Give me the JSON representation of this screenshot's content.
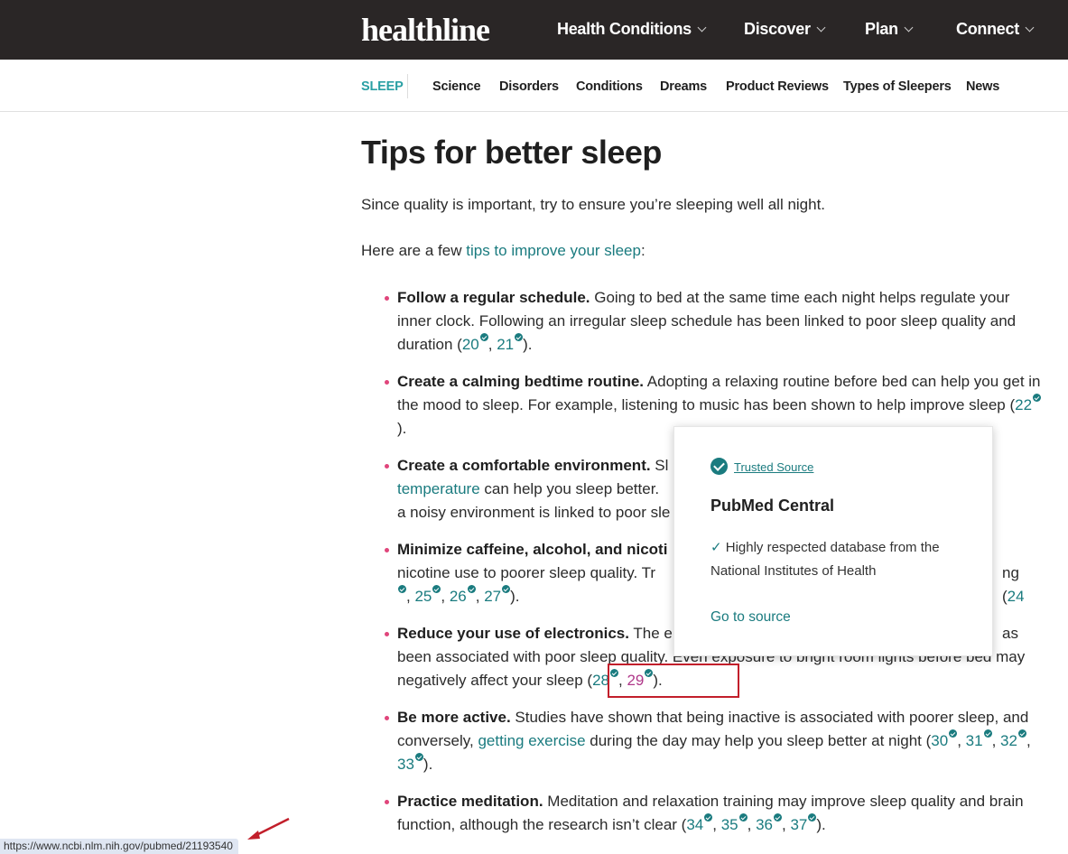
{
  "header": {
    "logo": "healthline",
    "nav": [
      {
        "label": "Health Conditions"
      },
      {
        "label": "Discover"
      },
      {
        "label": "Plan"
      },
      {
        "label": "Connect"
      }
    ]
  },
  "subnav": {
    "section": "SLEEP",
    "items": [
      "Science",
      "Disorders",
      "Conditions",
      "Dreams",
      "Product Reviews",
      "Types of Sleepers",
      "News"
    ]
  },
  "article": {
    "title": "Tips for better sleep",
    "intro": "Since quality is important, try to ensure you’re sleeping well all night.",
    "lead_prefix": "Here are a few ",
    "lead_link": "tips to improve your sleep",
    "lead_suffix": ":",
    "tips": [
      {
        "bold": "Follow a regular schedule.",
        "text": " Going to bed at the same time each night helps regulate your inner clock. Following an irregular sleep schedule has been linked to poor sleep quality and duration (",
        "cites": [
          "20",
          "21"
        ],
        "end": ")."
      },
      {
        "bold": "Create a calming bedtime routine.",
        "text": " Adopting a relaxing routine before bed can help you get in the mood to sleep. For example, listening to music has been shown to help improve sleep (",
        "cites": [
          "22"
        ],
        "end": ")."
      },
      {
        "bold": "Create a comfortable environment.",
        "text_a": " Sl",
        "link": "temperature",
        "text_b": " can help you sleep better.",
        "text_c": "a noisy environment is linked to poor sle"
      },
      {
        "bold": "Minimize caffeine, alcohol, and nicoti",
        "text": "nicotine use to poorer sleep quality. Tr",
        "tail": "ng (",
        "cites": [
          "24",
          "25",
          "26",
          "27"
        ],
        "end": ")."
      },
      {
        "bold": "Reduce your use of electronics.",
        "text_a": " The e",
        "text_b": "as been associated with poor sleep quality. Even exposure to bright room lights before bed may negatively affect your sleep (",
        "cites": [
          "28",
          "29"
        ],
        "end": ")."
      },
      {
        "bold": "Be more active.",
        "text_a": " Studies have shown that being inactive is associated with poorer sleep, and conversely, ",
        "link": "getting exercise",
        "text_b": " during the day may help you sleep better at night (",
        "cites": [
          "30",
          "31",
          "32",
          "33"
        ],
        "end": ")."
      },
      {
        "bold": "Practice meditation.",
        "text": " Meditation and relaxation training may improve sleep quality and brain function, although the research isn’t clear (",
        "cites": [
          "34",
          "35",
          "36",
          "37"
        ],
        "end": ")."
      }
    ]
  },
  "popup": {
    "badge_label": "Trusted Source",
    "source_name": "PubMed Central",
    "tick": "✓",
    "description": " Highly respected database from the National Institutes of Health",
    "link": "Go to source"
  },
  "status_bar": {
    "url": "https://www.ncbi.nlm.nih.gov/pubmed/21193540"
  },
  "colors": {
    "header_bg": "#2a2626",
    "accent_teal": "#1a7b7f",
    "section_teal": "#2aa0a4",
    "bullet_pink": "#e0457b",
    "visited_link": "#b0388a",
    "annotation_red": "#c21f2b"
  }
}
